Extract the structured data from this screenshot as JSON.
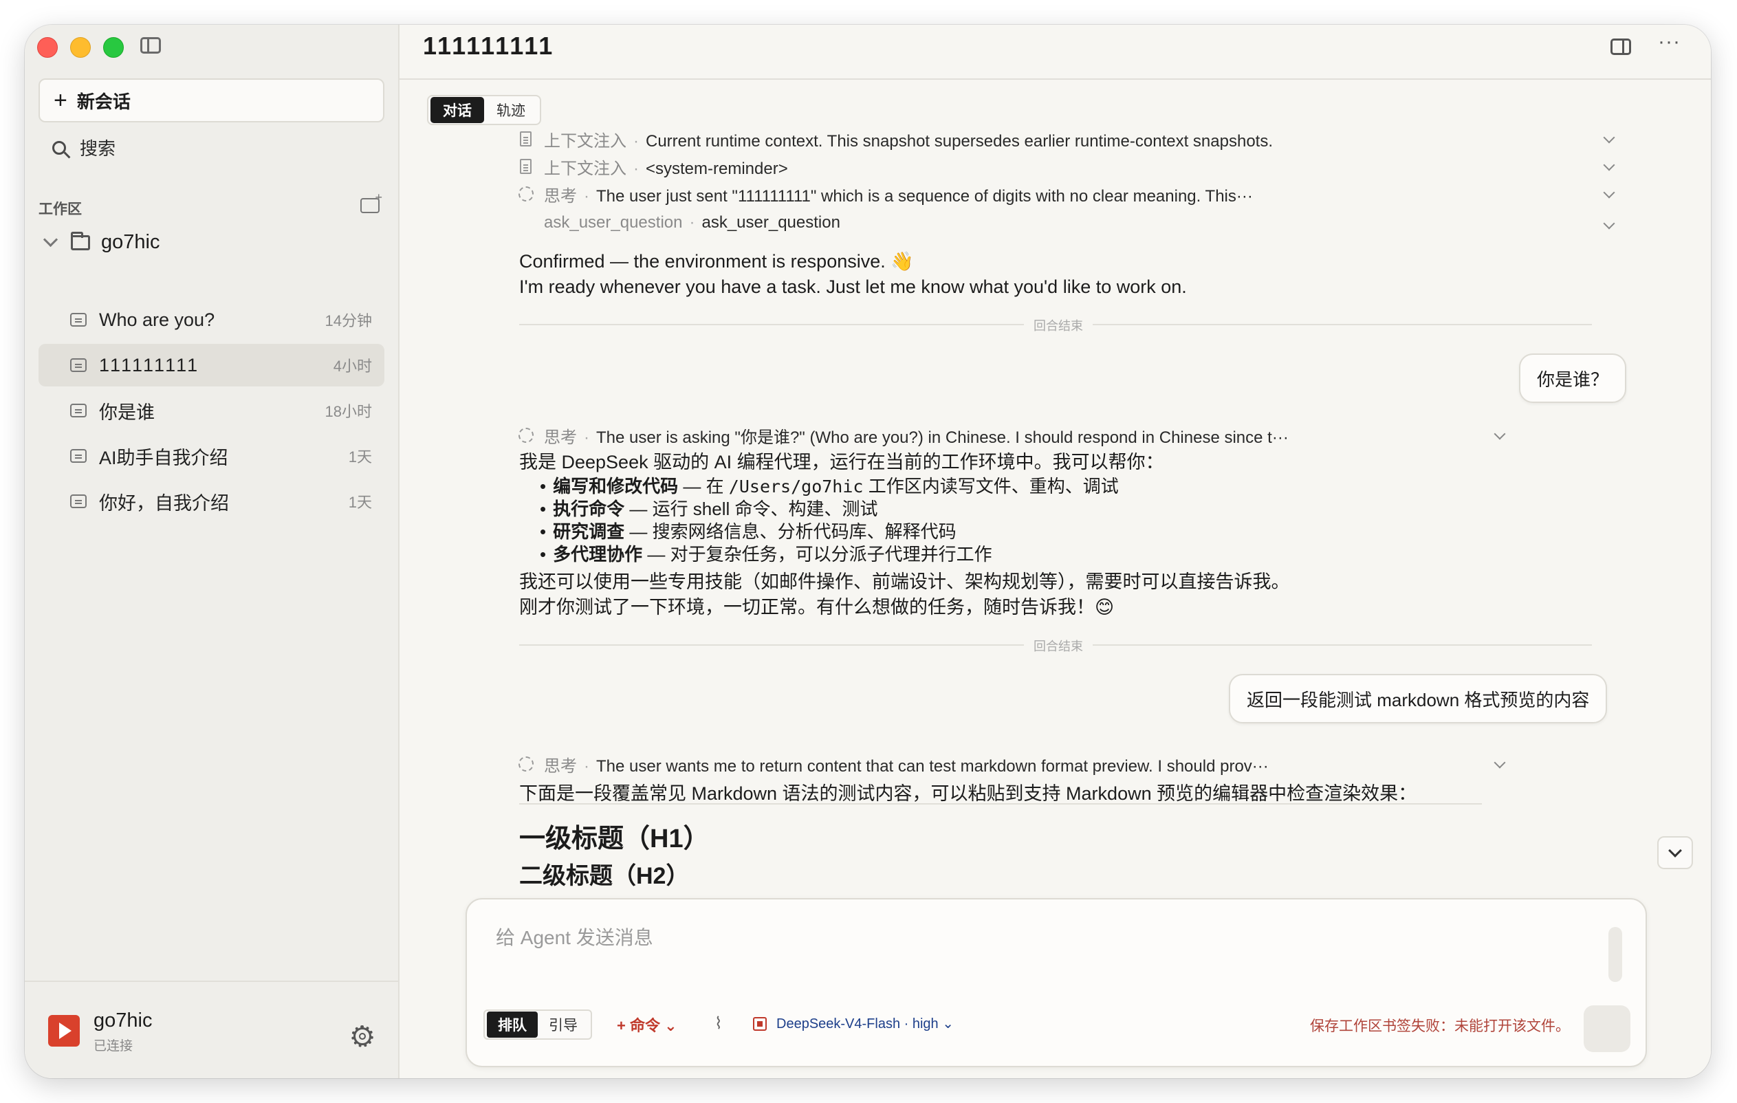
{
  "sidebar": {
    "new_chat_label": "新会话",
    "search_label": "搜索",
    "workspace_label": "工作区",
    "project_name": "go7hic",
    "chats": [
      {
        "title": "Who are you?",
        "time": "14分钟"
      },
      {
        "title": "111111111",
        "time": "4小时"
      },
      {
        "title": "你是谁",
        "time": "18小时"
      },
      {
        "title": "AI助手自我介绍",
        "time": "1天"
      },
      {
        "title": "你好，自我介绍",
        "time": "1天"
      }
    ],
    "active_index": 1,
    "user_name": "go7hic",
    "user_status": "已连接"
  },
  "header": {
    "title": "111111111",
    "more": "···"
  },
  "view_tabs": [
    "对话",
    "轨迹"
  ],
  "turn1": {
    "events": [
      {
        "label": "上下文注入",
        "text": "Current runtime context. This snapshot supersedes earlier runtime-context snapshots."
      },
      {
        "label": "上下文注入",
        "text": "<system-reminder>"
      },
      {
        "label": "思考",
        "text": "The user just sent \"111111111\" which is a sequence of digits with no clear meaning. This···"
      },
      {
        "label": "ask_user_question",
        "text": "ask_user_question"
      }
    ],
    "reply_line1": "Confirmed — the environment is responsive. 👋",
    "reply_line2": "I'm ready whenever you have a task. Just let me know what you'd like to work on.",
    "end_label": "回合结束"
  },
  "turn2": {
    "user_message": "你是谁？",
    "thinking_label": "思考",
    "thinking_text": "The user is asking \"你是谁?\" (Who are you?) in Chinese. I should respond in Chinese since t···",
    "intro": "我是 DeepSeek 驱动的 AI 编程代理，运行在当前的工作环境中。我可以帮你：",
    "bullets": [
      {
        "bold": "编写和修改代码",
        "rest_pre": " — 在 ",
        "code": "/Users/go7hic",
        "rest_post": " 工作区内读写文件、重构、调试"
      },
      {
        "bold": "执行命令",
        "rest_pre": " — 运行 shell 命令、构建、测试",
        "code": "",
        "rest_post": ""
      },
      {
        "bold": "研究调查",
        "rest_pre": " — 搜索网络信息、分析代码库、解释代码",
        "code": "",
        "rest_post": ""
      },
      {
        "bold": "多代理协作",
        "rest_pre": " — 对于复杂任务，可以分派子代理并行工作",
        "code": "",
        "rest_post": ""
      }
    ],
    "para1": "我还可以使用一些专用技能（如邮件操作、前端设计、架构规划等），需要时可以直接告诉我。",
    "para2": "刚才你测试了一下环境，一切正常。有什么想做的任务，随时告诉我！😊",
    "end_label": "回合结束"
  },
  "turn3": {
    "user_message": "返回一段能测试 markdown 格式预览的内容",
    "thinking_label": "思考",
    "thinking_text": "The user wants me to return content that can test markdown format preview. I should prov···",
    "intro": "下面是一段覆盖常见 Markdown 语法的测试内容，可以粘贴到支持 Markdown 预览的编辑器中检查渲染效果：",
    "h1": "一级标题（H1）",
    "h2": "二级标题（H2）"
  },
  "composer": {
    "placeholder": "给 Agent 发送消息",
    "modes": [
      "排队",
      "引导"
    ],
    "command_label": "+ 命令 ⌄",
    "model_label": "DeepSeek-V4-Flash · high ⌄",
    "warning": "保存工作区书签失败：未能打开该文件。"
  }
}
